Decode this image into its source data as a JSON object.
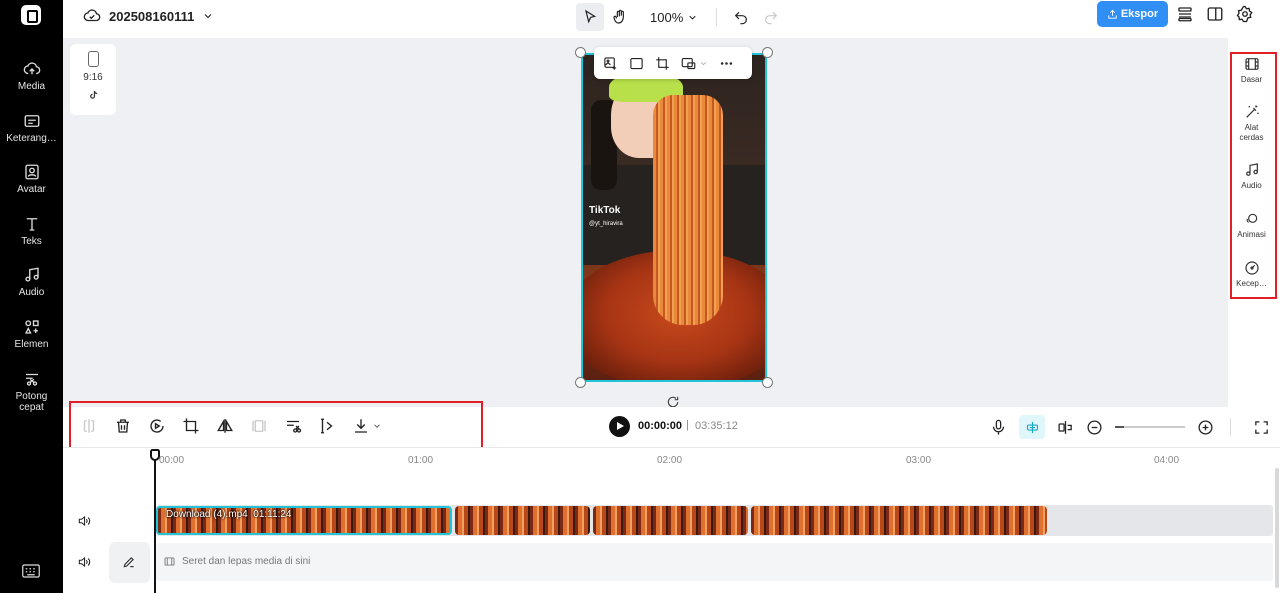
{
  "left_nav": {
    "items": [
      {
        "label": "Media",
        "icon": "cloud-upload-icon"
      },
      {
        "label": "Keterang…",
        "icon": "captions-icon"
      },
      {
        "label": "Avatar",
        "icon": "avatar-icon"
      },
      {
        "label": "Teks",
        "icon": "text-icon"
      },
      {
        "label": "Audio",
        "icon": "music-note-icon"
      },
      {
        "label": "Elemen",
        "icon": "elements-icon"
      },
      {
        "label": "Potong",
        "icon": "scissors-icon"
      }
    ],
    "item7_second_line": "cepat"
  },
  "topbar": {
    "project_name": "202508160111",
    "zoom": "100%",
    "export_label": "Ekspor",
    "accent": "#2f8ff5"
  },
  "canvas": {
    "aspect_ratio": "9:16",
    "bg": "#eef0f3",
    "selection_color": "#22c4d9",
    "video": {
      "watermark": "TikTok",
      "handle": "@yt_hiravira"
    }
  },
  "right_panel": {
    "items": [
      {
        "label": "Dasar",
        "icon": "film-icon"
      },
      {
        "label": "Alat cerdas",
        "icon": "magic-wand-icon"
      },
      {
        "label": "Audio",
        "icon": "music-note-icon"
      },
      {
        "label": "Animasi",
        "icon": "animation-icon"
      },
      {
        "label": "Kecep…",
        "icon": "speed-icon"
      }
    ],
    "highlight_color": "#e21e26"
  },
  "timeline_toolbar": {
    "current_time": "00:00:00",
    "separator": "|",
    "total_time": "03:35:12"
  },
  "timeline": {
    "ruler_labels": [
      "00:00",
      "01:00",
      "02:00",
      "03:00",
      "04:00"
    ],
    "clip_name": "Download (4).mp4",
    "clip_duration": "01:11:24",
    "drop_text": "Seret dan lepas media di sini"
  }
}
